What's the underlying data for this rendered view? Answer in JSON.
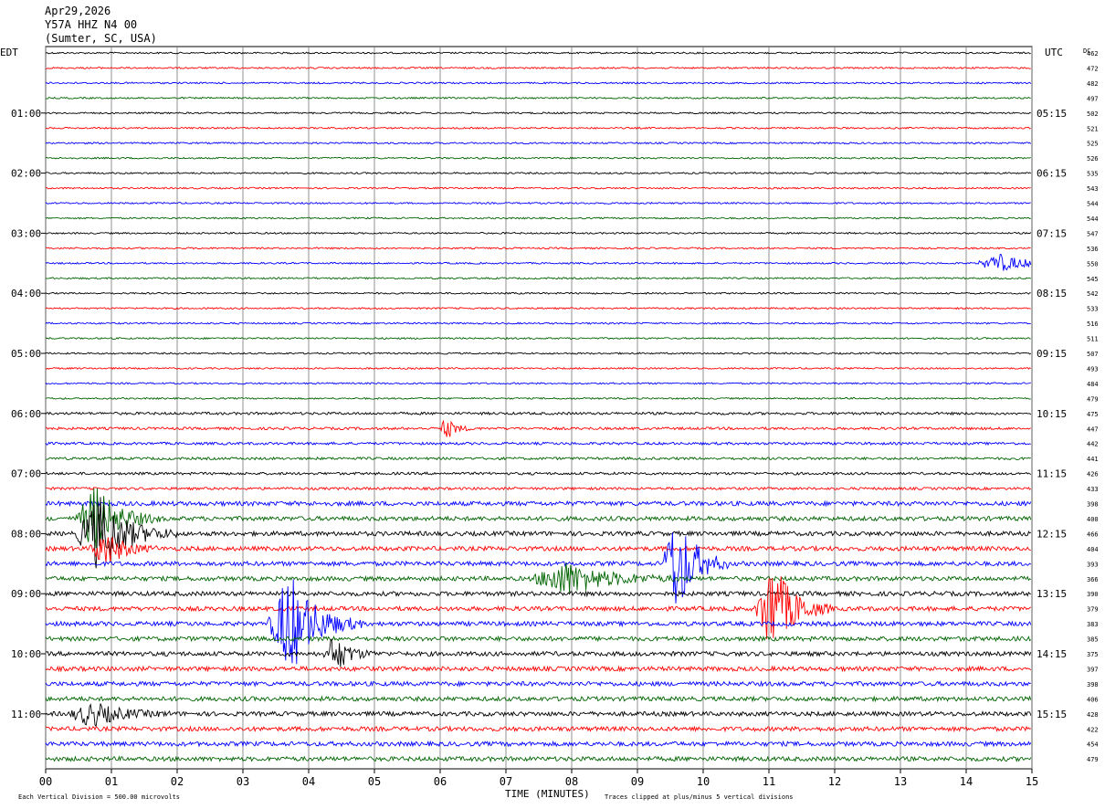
{
  "header": {
    "date": "Apr29,2026",
    "station": "Y57A HHZ N4 00",
    "location": "(Sumter, SC, USA)"
  },
  "chart_data": {
    "type": "line",
    "title": "Apr29,2026 Y57A HHZ N4 00 (Sumter, SC, USA)",
    "left_axis_label": "EDT",
    "right_axis_label": "UTC",
    "dc_label": "DC",
    "xlabel": "TIME (MINUTES)",
    "xlim": [
      0,
      15
    ],
    "x_ticks": [
      "00",
      "01",
      "02",
      "03",
      "04",
      "05",
      "06",
      "07",
      "08",
      "09",
      "10",
      "11",
      "12",
      "13",
      "14",
      "15"
    ],
    "left_time_labels": [
      "01:00",
      "02:00",
      "03:00",
      "04:00",
      "05:00",
      "06:00",
      "07:00",
      "08:00",
      "09:00",
      "10:00",
      "11:00"
    ],
    "right_time_labels": [
      "05:15",
      "06:15",
      "07:15",
      "08:15",
      "09:15",
      "10:15",
      "11:15",
      "12:15",
      "13:15",
      "14:15",
      "15:15"
    ],
    "dc_offsets": [
      462,
      472,
      482,
      497,
      502,
      521,
      525,
      526,
      535,
      543,
      544,
      544,
      547,
      536,
      550,
      545,
      542,
      533,
      516,
      511,
      507,
      493,
      484,
      479,
      475,
      447,
      442,
      441,
      426,
      433,
      398,
      400,
      466,
      404,
      393,
      366,
      390,
      379,
      383,
      385,
      375,
      397,
      398,
      406,
      428,
      422,
      454,
      479
    ],
    "trace_colors": [
      "#000000",
      "#ff0000",
      "#0000ff",
      "#006400"
    ],
    "trace_minutes": 15,
    "events": [
      {
        "trace": 31,
        "minute": 0.75,
        "amplitude": 2.2,
        "duration": 1.0
      },
      {
        "trace": 32,
        "minute": 0.8,
        "amplitude": 2.5,
        "duration": 1.2
      },
      {
        "trace": 33,
        "minute": 0.9,
        "amplitude": 1.2,
        "duration": 0.8
      },
      {
        "trace": 34,
        "minute": 9.6,
        "amplitude": 3.5,
        "duration": 0.8
      },
      {
        "trace": 35,
        "minute": 7.9,
        "amplitude": 1.1,
        "duration": 1.8
      },
      {
        "trace": 37,
        "minute": 11.05,
        "amplitude": 3.2,
        "duration": 0.9
      },
      {
        "trace": 38,
        "minute": 3.7,
        "amplitude": 3.5,
        "duration": 1.1
      },
      {
        "trace": 40,
        "minute": 4.4,
        "amplitude": 1.3,
        "duration": 0.6
      },
      {
        "trace": 44,
        "minute": 0.7,
        "amplitude": 0.8,
        "duration": 1.2
      },
      {
        "trace": 14,
        "minute": 14.5,
        "amplitude": 0.6,
        "duration": 1.2
      },
      {
        "trace": 25,
        "minute": 6.1,
        "amplitude": 0.7,
        "duration": 0.4
      }
    ],
    "legend_left": "Each Vertical Division =  500.00 microvolts",
    "legend_right": "Traces clipped at plus/minus 5 vertical divisions",
    "grid": true
  }
}
